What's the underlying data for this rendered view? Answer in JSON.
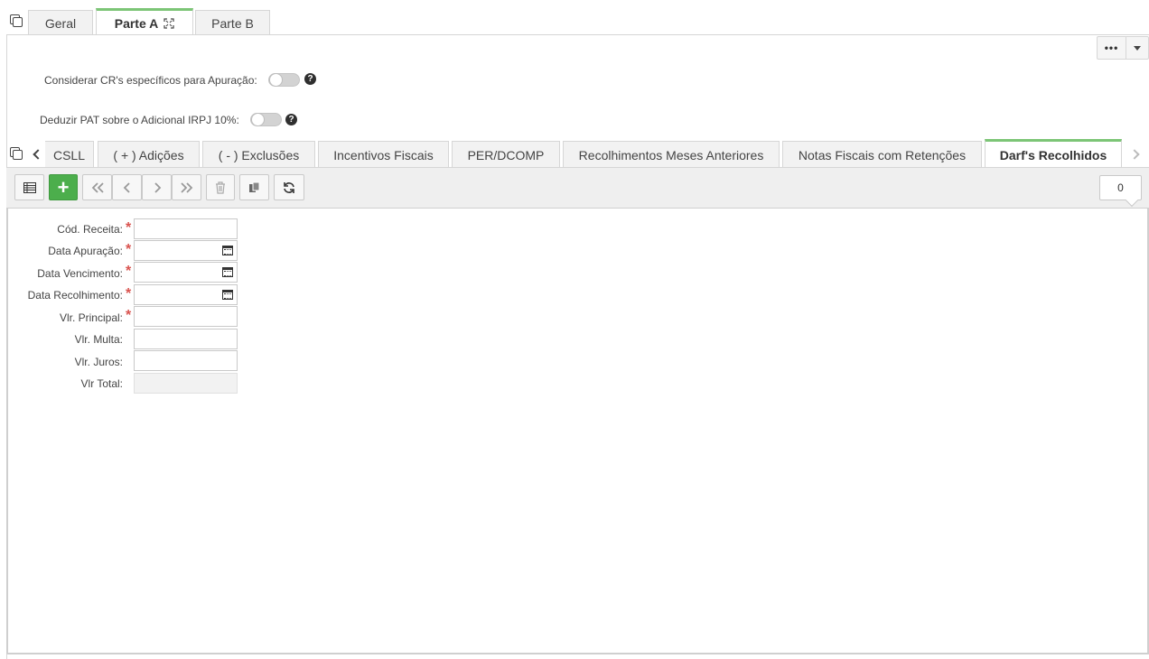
{
  "top_tabs": [
    {
      "label": "Geral"
    },
    {
      "label": "Parte A",
      "active": true,
      "icon": "expand-icon"
    },
    {
      "label": "Parte B"
    }
  ],
  "options": [
    {
      "label": "Considerar CR's específicos para Apuração:",
      "enabled": false
    },
    {
      "label": "Deduzir PAT sobre o Adicional IRPJ 10%:",
      "enabled": false
    }
  ],
  "more_menu": {
    "label": "•••"
  },
  "sub_tabs": [
    {
      "label": "CSLL"
    },
    {
      "label": "( + ) Adições"
    },
    {
      "label": "( - ) Exclusões"
    },
    {
      "label": "Incentivos Fiscais"
    },
    {
      "label": "PER/DCOMP"
    },
    {
      "label": "Recolhimentos Meses Anteriores"
    },
    {
      "label": "Notas Fiscais com Retenções"
    },
    {
      "label": "Darf's Recolhidos",
      "active": true
    }
  ],
  "toolbar": {
    "icons": [
      "grid-view-icon",
      "add-icon",
      "first-record-icon",
      "previous-record-icon",
      "next-record-icon",
      "last-record-icon",
      "delete-icon",
      "copy-record-icon",
      "refresh-icon"
    ],
    "add_label": "+",
    "record_count": "0"
  },
  "form": {
    "fields": [
      {
        "label": "Cód. Receita:",
        "required": true,
        "value": ""
      },
      {
        "label": "Data Apuração:",
        "required": true,
        "value": "",
        "type": "date"
      },
      {
        "label": "Data Vencimento:",
        "required": true,
        "value": "",
        "type": "date"
      },
      {
        "label": "Data Recolhimento:",
        "required": true,
        "value": "",
        "type": "date"
      },
      {
        "label": "Vlr. Principal:",
        "required": true,
        "value": ""
      },
      {
        "label": "Vlr. Multa:",
        "required": false,
        "value": ""
      },
      {
        "label": "Vlr. Juros:",
        "required": false,
        "value": ""
      },
      {
        "label": "Vlr Total:",
        "required": false,
        "value": "",
        "readonly": true
      }
    ],
    "required_mark": "*"
  },
  "colors": {
    "accent": "#7cc576",
    "add_button": "#4cae4c",
    "required": "#d9534f"
  }
}
